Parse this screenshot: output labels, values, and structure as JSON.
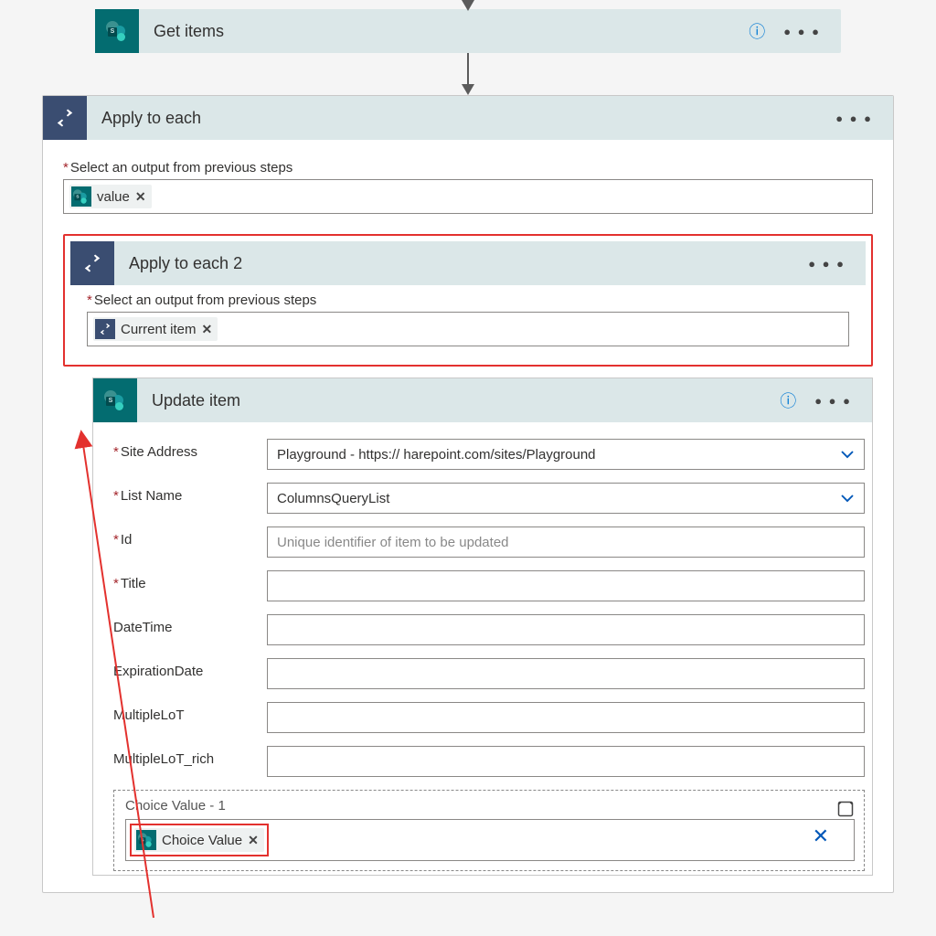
{
  "get_items": {
    "title": "Get items"
  },
  "apply_each": {
    "title": "Apply to each",
    "output_label": "Select an output from previous steps",
    "token": "value"
  },
  "apply_each_2": {
    "title": "Apply to each 2",
    "output_label": "Select an output from previous steps",
    "token": "Current item"
  },
  "update_item": {
    "title": "Update item",
    "fields": {
      "site_address": {
        "label": "Site Address",
        "value": "Playground - https://             harepoint.com/sites/Playground"
      },
      "list_name": {
        "label": "List Name",
        "value": "ColumnsQueryList"
      },
      "id": {
        "label": "Id",
        "placeholder": "Unique identifier of item to be updated"
      },
      "title": {
        "label": "Title"
      },
      "datetime": {
        "label": "DateTime"
      },
      "expiration": {
        "label": "ExpirationDate"
      },
      "multlot": {
        "label": "MultipleLoT"
      },
      "multlotrich": {
        "label": "MultipleLoT_rich"
      },
      "choice_group": {
        "label": "Choice Value - 1",
        "token": "Choice Value"
      }
    }
  }
}
